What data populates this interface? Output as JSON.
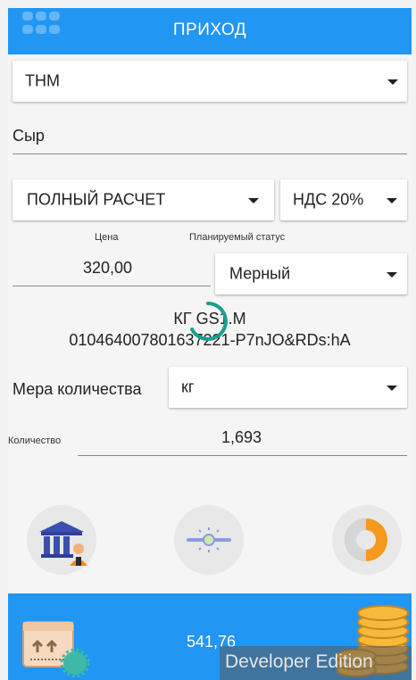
{
  "header": {
    "title": "ПРИХОД",
    "menu_icon": "grid-icon"
  },
  "organization_select": {
    "value": "ТНМ"
  },
  "product_name": {
    "value": "Сыр"
  },
  "payment_type_select": {
    "value": "ПОЛНЫЙ РАСЧЕТ"
  },
  "vat_select": {
    "value": "НДС 20%"
  },
  "price": {
    "label": "Цена",
    "value": "320,00"
  },
  "planned_status": {
    "label": "Планируемый статус",
    "value": "Мерный"
  },
  "marking_code": {
    "line1": "КГ GS1.M",
    "line2": "010464007801637221-P7nJO&RDs:hA"
  },
  "unit_measure": {
    "label": "Мера количества",
    "value": "кг"
  },
  "quantity": {
    "label": "Количество",
    "value": "1,693"
  },
  "actions": {
    "left": "bank-user-icon",
    "middle": "scanner-icon",
    "right": "pie-chart-icon"
  },
  "footer": {
    "total": "541,76",
    "watermark": "Developer Edition",
    "left_icon": "box-upload-icon",
    "right_icon": "coins-icon"
  },
  "colors": {
    "primary": "#2196f3",
    "spinner": "#1a9e8c",
    "orange": "#f59a1c"
  }
}
